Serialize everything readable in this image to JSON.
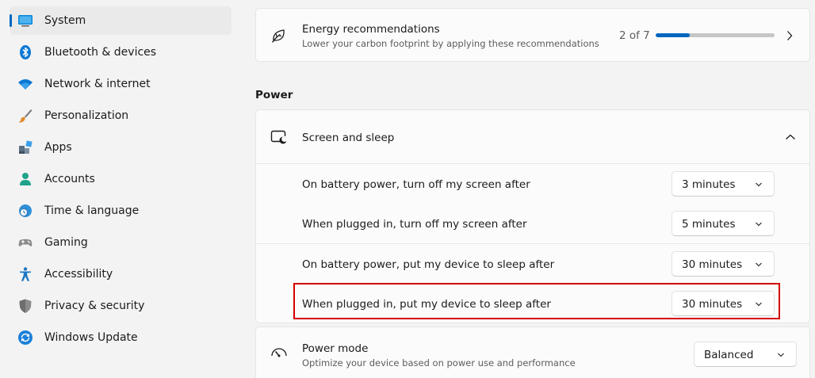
{
  "sidebar": {
    "items": [
      {
        "label": "System",
        "icon": "system-icon",
        "selected": true
      },
      {
        "label": "Bluetooth & devices",
        "icon": "bluetooth-icon"
      },
      {
        "label": "Network & internet",
        "icon": "wifi-icon"
      },
      {
        "label": "Personalization",
        "icon": "brush-icon"
      },
      {
        "label": "Apps",
        "icon": "apps-icon"
      },
      {
        "label": "Accounts",
        "icon": "accounts-icon"
      },
      {
        "label": "Time & language",
        "icon": "time-language-icon"
      },
      {
        "label": "Gaming",
        "icon": "gamepad-icon"
      },
      {
        "label": "Accessibility",
        "icon": "accessibility-icon"
      },
      {
        "label": "Privacy & security",
        "icon": "shield-icon"
      },
      {
        "label": "Windows Update",
        "icon": "update-icon"
      }
    ]
  },
  "energy": {
    "title": "Energy recommendations",
    "subtitle": "Lower your carbon footprint by applying these recommendations",
    "progress_text": "2 of 7",
    "progress_fraction": 0.286,
    "icon": "leaf-icon"
  },
  "power": {
    "heading": "Power",
    "screen_sleep": {
      "title": "Screen and sleep",
      "icon": "screen-sleep-icon",
      "rows": [
        {
          "label": "On battery power, turn off my screen after",
          "value": "3 minutes"
        },
        {
          "label": "When plugged in, turn off my screen after",
          "value": "5 minutes"
        },
        {
          "label": "On battery power, put my device to sleep after",
          "value": "30 minutes"
        },
        {
          "label": "When plugged in, put my device to sleep after",
          "value": "30 minutes"
        }
      ]
    },
    "power_mode": {
      "title": "Power mode",
      "subtitle": "Optimize your device based on power use and performance",
      "value": "Balanced",
      "icon": "gauge-icon"
    }
  },
  "colors": {
    "accent": "#0067c0",
    "highlight": "#d40000"
  }
}
